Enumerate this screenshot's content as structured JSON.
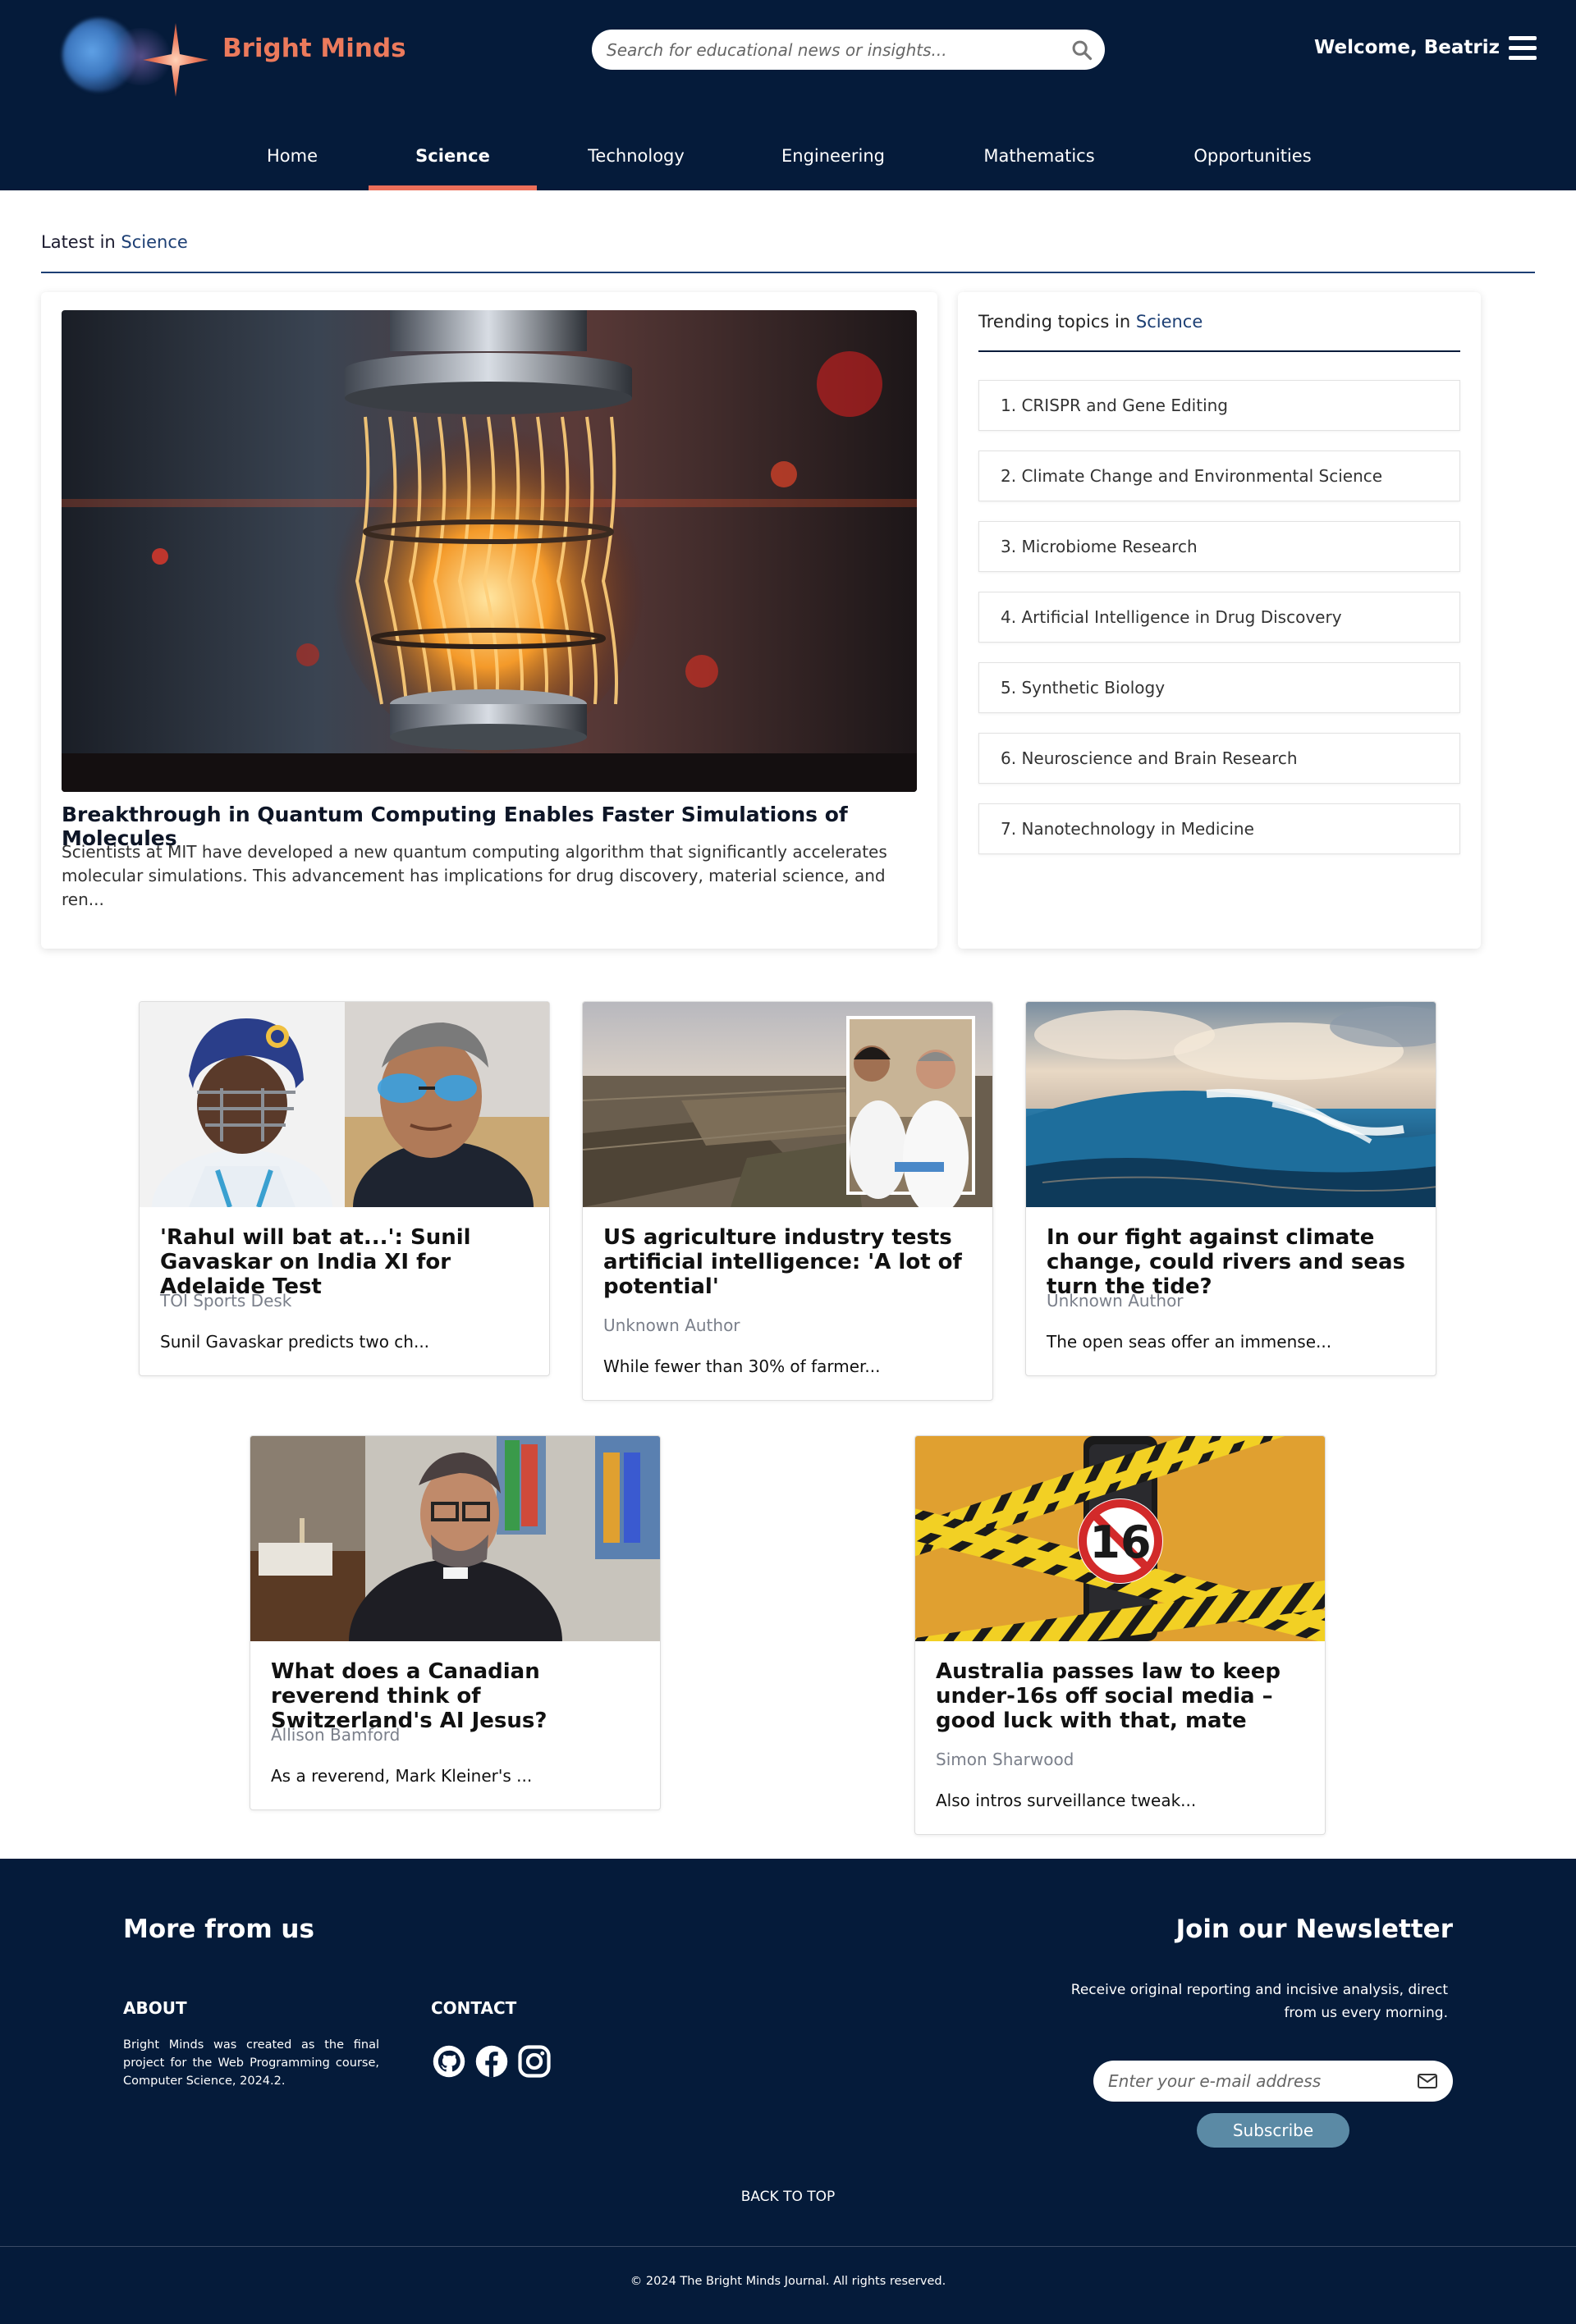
{
  "header": {
    "brand": "Bright Minds",
    "search_placeholder": "Search for educational news or insights...",
    "welcome": "Welcome, Beatriz",
    "icons": [
      "logo-star",
      "search-icon",
      "menu-icon"
    ]
  },
  "nav": {
    "items": [
      "Home",
      "Science",
      "Technology",
      "Engineering",
      "Mathematics",
      "Opportunities"
    ],
    "active": "Science"
  },
  "latest": {
    "prefix": "Latest in ",
    "category": "Science"
  },
  "feature": {
    "title": "Breakthrough in Quantum Computing Enables Faster Simulations of Molecules",
    "description": "Scientists at MIT have developed a new quantum computing algorithm that significantly accelerates molecular simulations. This advancement has implications for drug discovery, material science, and ren..."
  },
  "trending": {
    "prefix": "Trending topics in ",
    "category": "Science",
    "items": [
      "1. CRISPR and Gene Editing",
      "2. Climate Change and Environmental Science",
      "3. Microbiome Research",
      "4. Artificial Intelligence in Drug Discovery",
      "5. Synthetic Biology",
      "6. Neuroscience and Brain Research",
      "7. Nanotechnology in Medicine"
    ]
  },
  "articles": [
    {
      "title": "'Rahul will bat at...': Sunil Gavaskar on India XI for Adelaide Test",
      "author": "TOI Sports Desk",
      "snippet": "Sunil Gavaskar predicts two ch..."
    },
    {
      "title": "US agriculture industry tests artificial intelligence: 'A lot of potential'",
      "author": "Unknown Author",
      "snippet": "While fewer than 30% of farmer..."
    },
    {
      "title": "In our fight against climate change, could rivers and seas turn the tide?",
      "author": "Unknown Author",
      "snippet": "The open seas offer an immense..."
    },
    {
      "title": "What does a Canadian reverend think of Switzerland's AI Jesus?",
      "author": "Allison Bamford",
      "snippet": "As a reverend, Mark Kleiner's ..."
    },
    {
      "title": "Australia passes law to keep under-16s off social media – good luck with that, mate",
      "author": "Simon Sharwood",
      "snippet": "Also intros surveillance tweak..."
    }
  ],
  "footer": {
    "more_title": "More from us",
    "about_heading": "ABOUT",
    "about_text": "Bright Minds was created as the final project for the Web Programming course, Computer Science, 2024.2.",
    "contact_heading": "CONTACT",
    "social_icons": [
      "github-icon",
      "facebook-icon",
      "instagram-icon"
    ],
    "newsletter_title": "Join our Newsletter",
    "newsletter_text": "Receive original reporting and incisive analysis, direct from us every morning.",
    "email_placeholder": "Enter your e-mail address",
    "subscribe_label": "Subscribe",
    "back_to_top": "BACK TO TOP",
    "copyright": "© 2024 The Bright Minds Journal. All rights reserved."
  },
  "colors": {
    "navy": "#051b3a",
    "accent": "#ec7a5c",
    "link": "#1d3f74",
    "subscribe": "#5b8aa5"
  }
}
